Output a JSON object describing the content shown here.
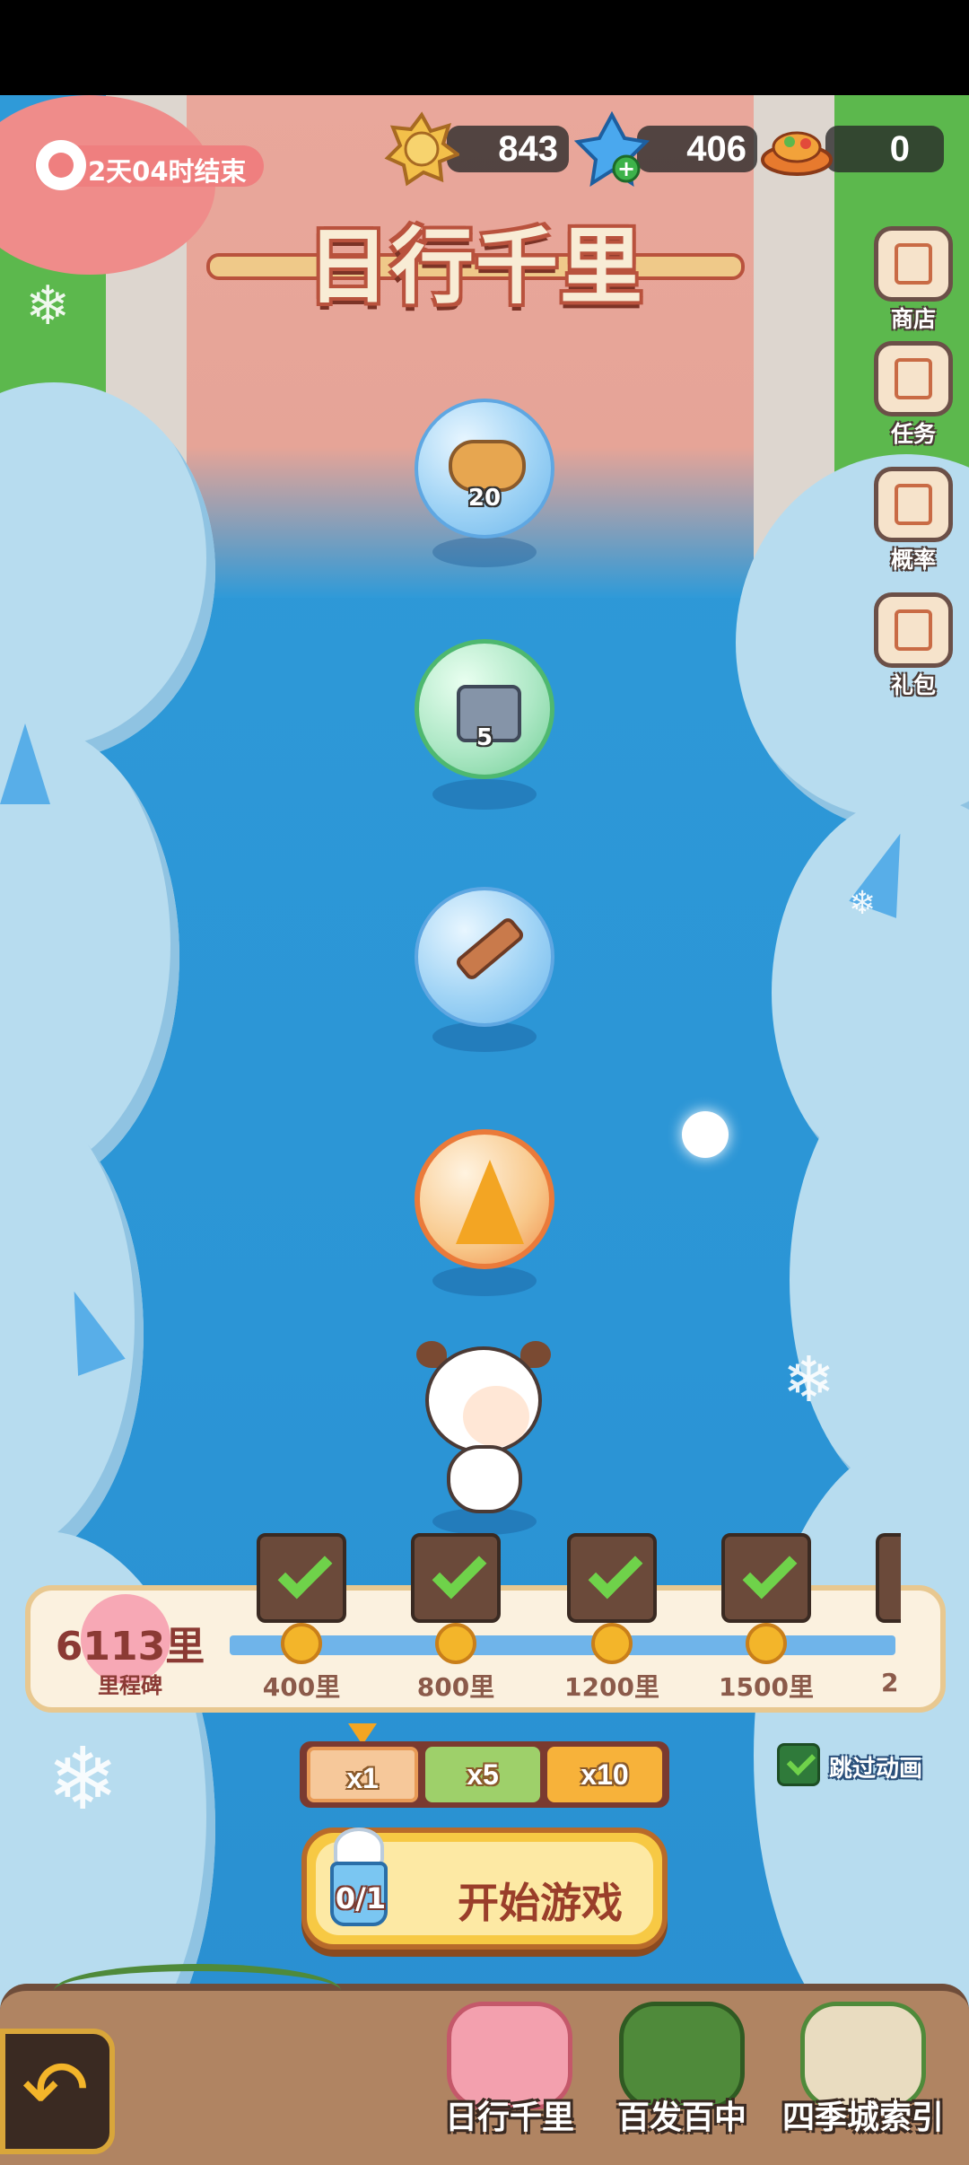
{
  "event": {
    "timer_text": "2天04时结束",
    "title": "日行千里"
  },
  "currencies": [
    {
      "name": "gold-coin",
      "value": "843",
      "icon": "gold-medal-icon"
    },
    {
      "name": "blue-crystal",
      "value": "406",
      "icon": "blue-crystal-add-icon"
    },
    {
      "name": "food-dish",
      "value": "0",
      "icon": "food-dish-icon"
    }
  ],
  "side_menu": [
    {
      "label": "商店",
      "icon": "shop-icon"
    },
    {
      "label": "任务",
      "icon": "task-icon"
    },
    {
      "label": "概率",
      "icon": "probability-icon"
    },
    {
      "label": "礼包",
      "icon": "gift-pack-icon"
    }
  ],
  "rewards": [
    {
      "item": "cat-bread",
      "count": "20",
      "style": "blue"
    },
    {
      "item": "iron-chest",
      "count": "5",
      "style": "green"
    },
    {
      "item": "dagger",
      "count": "",
      "style": "blue"
    },
    {
      "item": "golden-crystal",
      "count": "",
      "style": "orange"
    }
  ],
  "milestone": {
    "distance": "6113里",
    "label": "里程碑",
    "nodes": [
      {
        "label": "400里",
        "claimed": true
      },
      {
        "label": "800里",
        "claimed": true
      },
      {
        "label": "1200里",
        "claimed": true
      },
      {
        "label": "1500里",
        "claimed": true
      },
      {
        "label": "2",
        "claimed": false
      }
    ]
  },
  "multiplier": {
    "options": [
      "x1",
      "x5",
      "x10"
    ],
    "selected": "x1"
  },
  "skip_animation": {
    "label": "跳过动画",
    "checked": true
  },
  "start": {
    "label": "开始游戏",
    "tickets": "0/1"
  },
  "bottom_nav": [
    {
      "label": "日行千里",
      "icon": "pink-pavilion-icon",
      "active": true
    },
    {
      "label": "百发百中",
      "icon": "flower-target-icon",
      "active": false
    },
    {
      "label": "四季城索引",
      "icon": "map-flag-icon",
      "active": false
    }
  ],
  "colors": {
    "river": "#2f9ad8",
    "accent": "#f3b52a",
    "title_outline": "#b9523d"
  }
}
